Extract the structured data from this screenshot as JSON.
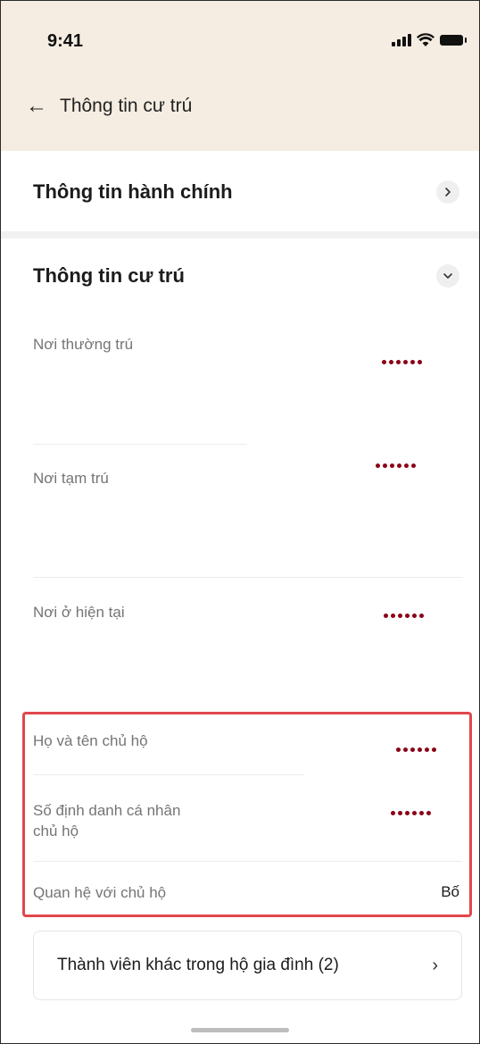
{
  "status_bar": {
    "time": "9:41"
  },
  "header": {
    "title": "Thông tin cư trú"
  },
  "sections": {
    "admin": {
      "title": "Thông tin hành chính"
    },
    "residence": {
      "title": "Thông tin cư trú"
    }
  },
  "fields": {
    "permanent": {
      "label": "Nơi thường trú",
      "value": "••••••"
    },
    "temporary": {
      "label": "Nơi tạm trú",
      "value": "••••••"
    },
    "current": {
      "label": "Nơi ở hiện tại",
      "value": "••••••"
    },
    "head_name": {
      "label": "Họ và tên chủ hộ",
      "value": "••••••"
    },
    "head_id": {
      "label_line1": "Số định danh cá nhân",
      "label_line2": "chủ hộ",
      "value": "••••••"
    },
    "relationship": {
      "label": "Quan hệ với chủ hộ",
      "value": "Bố"
    }
  },
  "members": {
    "label": "Thành viên khác trong hộ gia đình (2)"
  },
  "icons": {
    "back": "arrow-left-icon",
    "admin_chevron": "chevron-right-icon",
    "residence_chevron": "chevron-down-icon",
    "members_chevron": "chevron-right-icon"
  },
  "colors": {
    "header_bg": "#f6ede2",
    "masked_dot": "#8b0016",
    "highlight_border": "#e0474c"
  }
}
